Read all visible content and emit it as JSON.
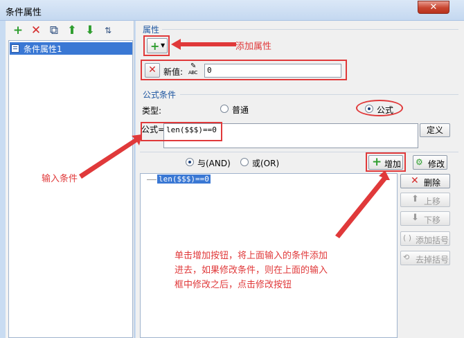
{
  "window": {
    "title": "条件属性",
    "close_glyph": "✕"
  },
  "left": {
    "tree_items": [
      "条件属性1"
    ]
  },
  "properties": {
    "group_label": "属性",
    "new_value_label": "新值:",
    "new_value": "0",
    "abc_text": "ABC"
  },
  "formula": {
    "group_label": "公式条件",
    "type_label": "类型:",
    "type_normal": "普通",
    "type_formula": "公式",
    "formula_label": "公式=",
    "formula_value": "len($$$)==0",
    "define_button": "定义",
    "and_label": "与(AND)",
    "or_label": "或(OR)",
    "add_button": "增加",
    "modify_button": "修改",
    "delete_button": "删除",
    "up_button": "上移",
    "down_button": "下移",
    "add_paren_button": "添加括号",
    "remove_paren_button": "去掉括号",
    "conditions": [
      "len($$$)==0"
    ]
  },
  "annotations": {
    "add_property": "添加属性",
    "input_condition": "输入条件",
    "instruction_line1": "单击增加按钮，将上面输入的条件添加",
    "instruction_line2": "进去，如果修改条件，则在上面的输入",
    "instruction_line3": "框中修改之后，点击修改按钮"
  },
  "colors": {
    "accent_red": "#e0393a",
    "selection_blue": "#3a78d4",
    "group_blue": "#1e56a0"
  }
}
